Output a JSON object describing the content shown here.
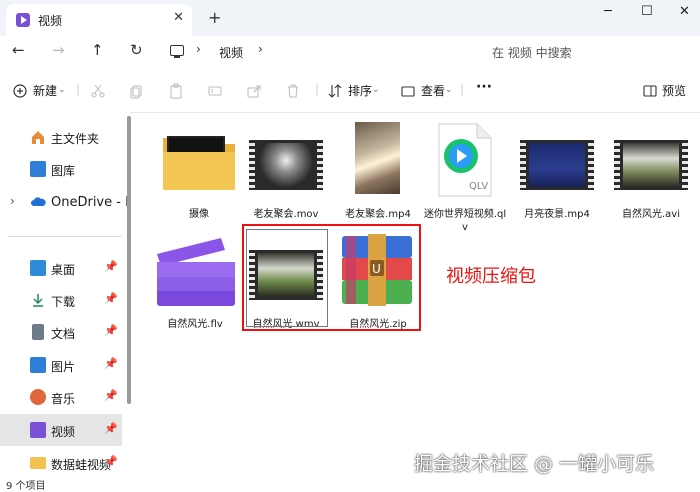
{
  "window": {
    "tab_title": "视频",
    "tab_close": "✕",
    "new_tab": "+",
    "minimize": "─",
    "maximize": "☐",
    "close": "✕"
  },
  "nav": {
    "back": "←",
    "forward": "→",
    "up": "↑",
    "refresh": "↻",
    "breadcrumb": [
      "视频"
    ],
    "search_placeholder": "在 视频 中搜索"
  },
  "toolbar": {
    "new_label": "新建",
    "sort_label": "排序",
    "view_label": "查看",
    "more_label": "···",
    "preview_label": "预览"
  },
  "sidebar": {
    "items": [
      {
        "label": "主文件夹",
        "icon": "home-icon"
      },
      {
        "label": "图库",
        "icon": "gallery-icon"
      },
      {
        "label": "OneDrive - I",
        "icon": "cloud-icon"
      },
      {
        "label": "桌面",
        "icon": "desktop-icon"
      },
      {
        "label": "下载",
        "icon": "download-icon"
      },
      {
        "label": "文档",
        "icon": "document-icon"
      },
      {
        "label": "图片",
        "icon": "pictures-icon"
      },
      {
        "label": "音乐",
        "icon": "music-icon"
      },
      {
        "label": "视频",
        "icon": "video-icon"
      },
      {
        "label": "数据蛙视频",
        "icon": "folder-icon"
      }
    ]
  },
  "files": [
    {
      "name": "摄像",
      "type": "folder"
    },
    {
      "name": "老友聚会.mov",
      "type": "video"
    },
    {
      "name": "老友聚会.mp4",
      "type": "photo"
    },
    {
      "name": "迷你世界短视频.qlv",
      "type": "qlv"
    },
    {
      "name": "月亮夜景.mp4",
      "type": "video"
    },
    {
      "name": "自然风光.avi",
      "type": "video"
    },
    {
      "name": "自然风光.flv",
      "type": "flv"
    },
    {
      "name": "自然风光.wmv",
      "type": "video"
    },
    {
      "name": "自然风光.zip",
      "type": "zip"
    }
  ],
  "annotation": "视频压缩包",
  "watermark": "掘金技术社区 @ 一罐小可乐",
  "status": "9 个项目",
  "colors": {
    "highlight": "#ee1111",
    "accent": "#7b4fd6"
  }
}
